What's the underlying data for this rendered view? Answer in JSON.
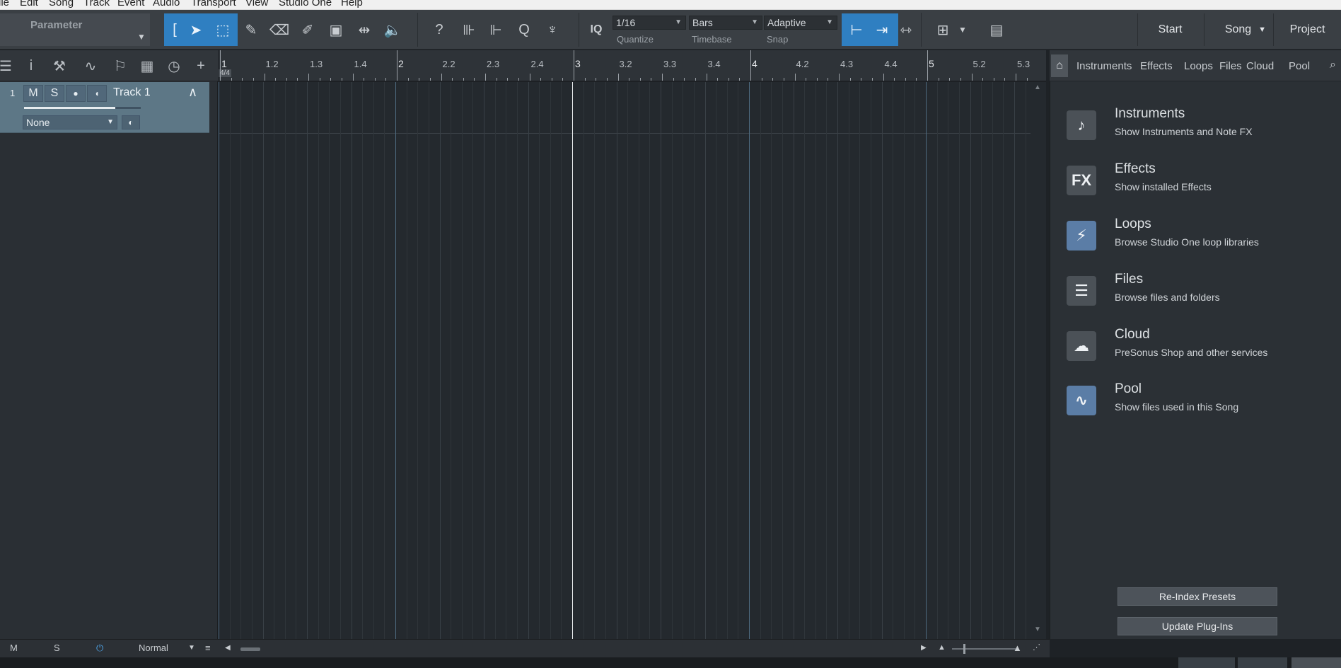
{
  "menu": [
    "ile",
    "Edit",
    "Song",
    "Track",
    "Event",
    "Audio",
    "Transport",
    "View",
    "Studio One",
    "Help"
  ],
  "toolbar": {
    "parameter_label": "Parameter",
    "iq_label": "IQ",
    "quantize": {
      "value": "1/16",
      "label": "Quantize"
    },
    "timebase": {
      "value": "Bars",
      "label": "Timebase"
    },
    "snap": {
      "value": "Adaptive",
      "label": "Snap"
    },
    "nav": {
      "start": "Start",
      "song": "Song",
      "project": "Project"
    }
  },
  "track": {
    "number": "1",
    "mute": "M",
    "solo": "S",
    "name": "Track 1",
    "input": "None",
    "volume_fraction": 0.78
  },
  "ruler": {
    "time_signature": "4/4",
    "labels": [
      "1",
      "1.2",
      "1.3",
      "1.4",
      "2",
      "2.2",
      "2.3",
      "2.4",
      "3",
      "3.2",
      "3.3",
      "3.4",
      "4",
      "4.2",
      "4.3",
      "4.4",
      "5",
      "5.2",
      "5.3"
    ]
  },
  "browser": {
    "tabs": [
      "Instruments",
      "Effects",
      "Loops",
      "Files",
      "Cloud",
      "Pool"
    ],
    "items": [
      {
        "title": "Instruments",
        "subtitle": "Show Instruments and Note FX",
        "icon": "piano-icon",
        "icon_glyph": "♪"
      },
      {
        "title": "Effects",
        "subtitle": "Show installed Effects",
        "icon": "fx-icon",
        "icon_glyph": "FX"
      },
      {
        "title": "Loops",
        "subtitle": "Browse Studio One loop libraries",
        "icon": "loops-icon",
        "icon_glyph": "⚡"
      },
      {
        "title": "Files",
        "subtitle": "Browse files and folders",
        "icon": "files-icon",
        "icon_glyph": "☰"
      },
      {
        "title": "Cloud",
        "subtitle": "PreSonus Shop and other services",
        "icon": "cloud-icon",
        "icon_glyph": "☁"
      },
      {
        "title": "Pool",
        "subtitle": "Show files used in this Song",
        "icon": "pool-icon",
        "icon_glyph": "∿"
      }
    ],
    "buttons": {
      "reindex": "Re-Index Presets",
      "update": "Update Plug-Ins"
    }
  },
  "bottom": {
    "m": "M",
    "s": "S",
    "mode": "Normal"
  },
  "colors": {
    "accent": "#2f7fc1",
    "track": "#5d7786",
    "icon_blue": "#5b7da6",
    "icon_gray": "#4b5157"
  }
}
